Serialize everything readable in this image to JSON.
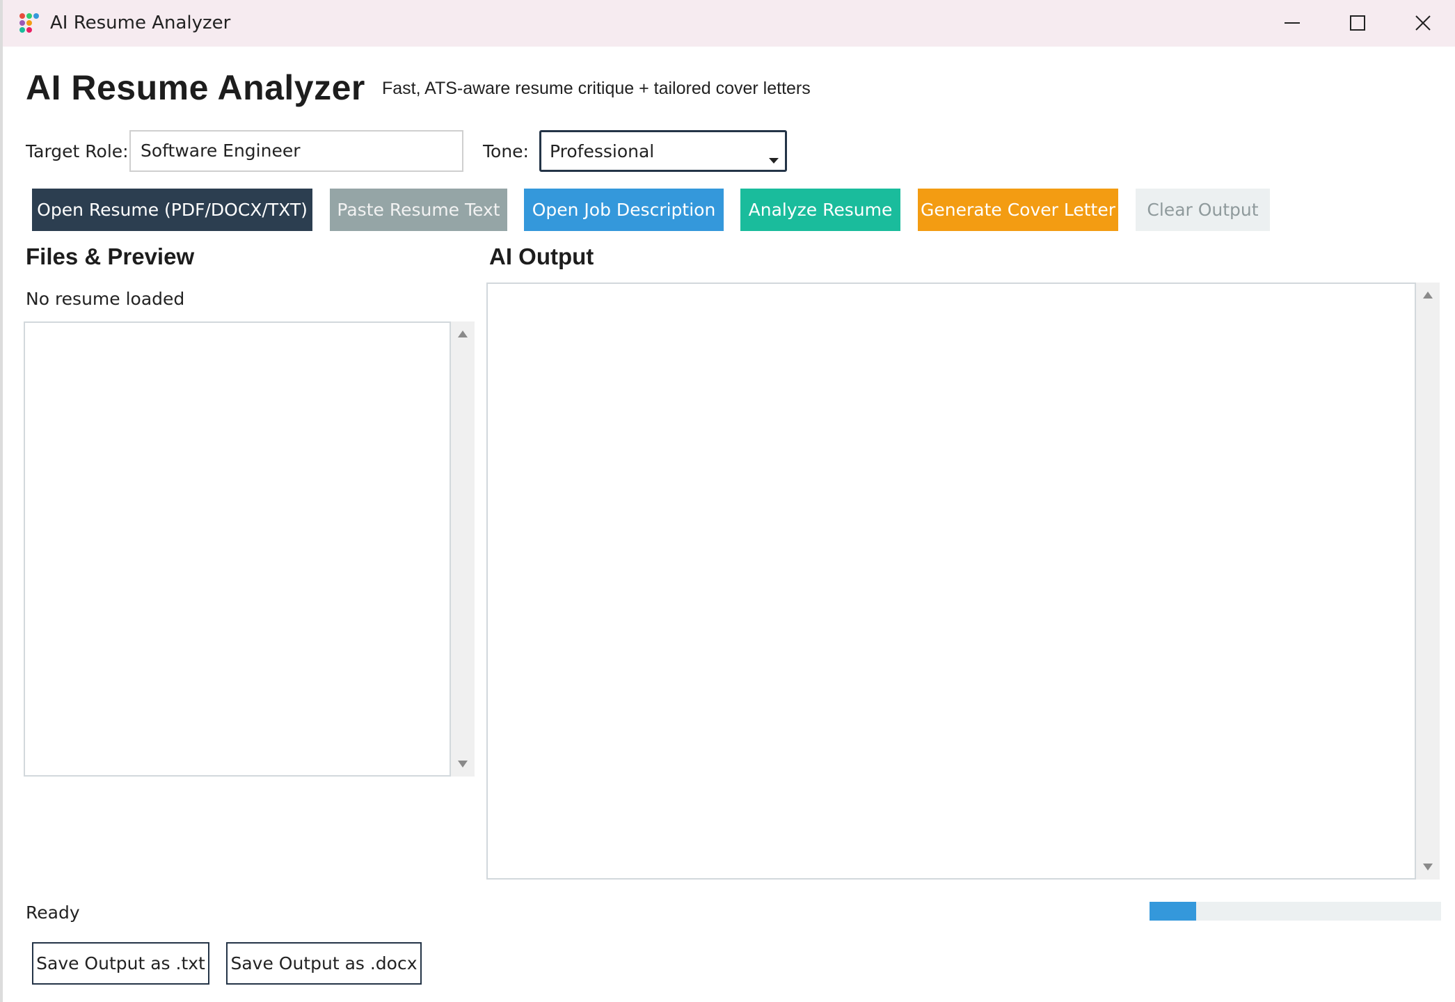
{
  "window": {
    "title": "AI Resume Analyzer",
    "icon": "app-dots-icon",
    "controls": [
      "minimize-icon",
      "maximize-icon",
      "close-icon"
    ]
  },
  "header": {
    "title": "AI Resume Analyzer",
    "subtitle": "Fast, ATS-aware resume critique + tailored cover letters"
  },
  "form": {
    "role_label": "Target Role:",
    "role_value": "Software Engineer",
    "tone_label": "Tone:",
    "tone_value": "Professional"
  },
  "toolbar": {
    "open_resume": "Open Resume (PDF/DOCX/TXT)",
    "paste_resume": "Paste Resume Text",
    "open_job": "Open Job Description",
    "analyze": "Analyze Resume",
    "cover_letter": "Generate Cover Letter",
    "clear": "Clear Output"
  },
  "colors": {
    "open_resume": "#2c3e50",
    "paste_resume": "#95a5a6",
    "open_job": "#3498db",
    "analyze": "#1abc9c",
    "cover_letter": "#f39c12",
    "clear": "#ecf0f1"
  },
  "files": {
    "title": "Files & Preview",
    "status": "No resume loaded"
  },
  "output": {
    "title": "AI Output"
  },
  "footer": {
    "status": "Ready",
    "progress_fraction": 0.16,
    "save_txt": "Save Output as .txt",
    "save_docx": "Save Output as .docx"
  }
}
